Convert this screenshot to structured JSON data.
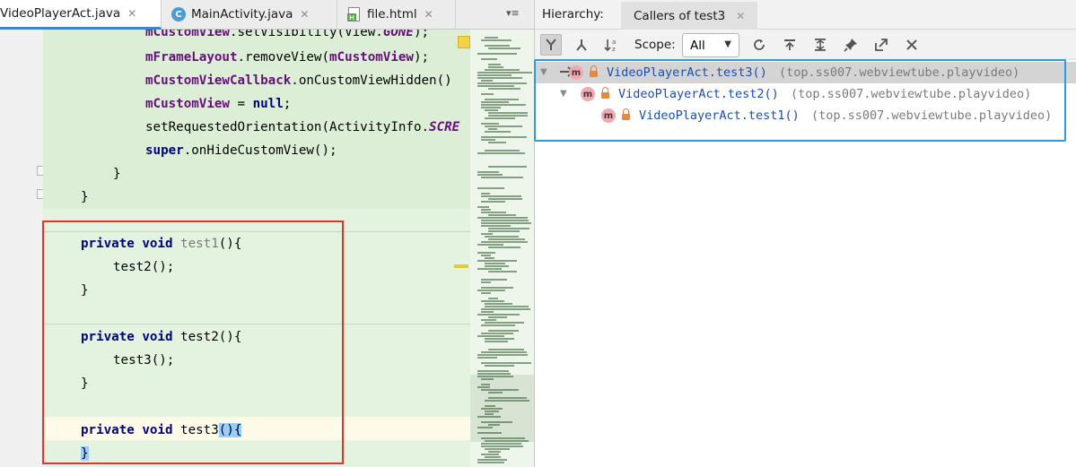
{
  "editor": {
    "tabs": [
      {
        "label": "VideoPlayerAct.java",
        "icon": "java-class-icon",
        "active": true
      },
      {
        "label": "MainActivity.java",
        "icon": "java-class-c-icon",
        "active": false
      },
      {
        "label": "file.html",
        "icon": "html-file-icon",
        "active": false
      }
    ],
    "tab_menu": "▾≡",
    "code": {
      "l0_a": "mCustomView",
      "l0_b": ".setVisibility(View.",
      "l0_c": "GONE",
      "l0_d": ");",
      "l1_a": "mFrameLayout",
      "l1_b": ".removeView(",
      "l1_c": "mCustomView",
      "l1_d": ");",
      "l2_a": "mCustomViewCallback",
      "l2_b": ".onCustomViewHidden()",
      "l3_a": "mCustomView",
      "l3_b": " = ",
      "l3_c": "null",
      "l3_d": ";",
      "l4_a": "setRequestedOrientation(ActivityInfo.",
      "l4_b": "SCRE",
      "l5_a": "super",
      "l5_b": ".onHideCustomView();",
      "l6": "}",
      "l7": "}",
      "m1_kw": "private void ",
      "m1_name": "test1",
      "m1_tail": "(){",
      "m1_call": "test2();",
      "m1_close": "}",
      "m2_kw": "private void ",
      "m2_name": "test2",
      "m2_tail": "(){",
      "m2_call": "test3();",
      "m2_close": "}",
      "m3_kw": "private void ",
      "m3_name": "test3",
      "m3_paren": "()",
      "m3_brace": "{",
      "m3_close": "}"
    },
    "colors": {
      "code_bg": "#e3f3e0",
      "keyword": "#000080",
      "field": "#660e7a",
      "highlight_box": "#e5322d"
    }
  },
  "hierarchy": {
    "title": "Hierarchy:",
    "tab_label": "Callers of test3",
    "scope_label": "Scope:",
    "scope_value": "All",
    "toolbar_icons": [
      "caller-hierarchy-icon",
      "callee-hierarchy-icon",
      "sort-alpha-icon",
      "refresh-icon",
      "export-icon",
      "expand-all-icon",
      "pin-icon",
      "open-in-editor-icon",
      "close-icon"
    ],
    "tree": [
      {
        "method": "VideoPlayerAct.test3()",
        "package": "(top.ss007.webviewtube.playvideo)",
        "depth": 0,
        "selected": true,
        "expanded": true,
        "root": true
      },
      {
        "method": "VideoPlayerAct.test2()",
        "package": "(top.ss007.webviewtube.playvideo)",
        "depth": 1,
        "selected": false,
        "expanded": true
      },
      {
        "method": "VideoPlayerAct.test1()",
        "package": "(top.ss007.webviewtube.playvideo)",
        "depth": 2,
        "selected": false,
        "expanded": false
      }
    ],
    "method_icon_letter": "m",
    "colors": {
      "method_link": "#1d4ea8",
      "highlight_box": "#2d9be3"
    }
  }
}
